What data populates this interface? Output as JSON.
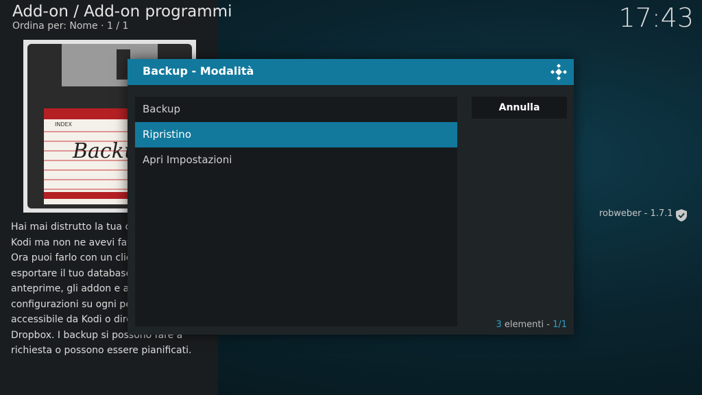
{
  "header": {
    "title": "Add-on / Add-on programmi",
    "subtitle": "Ordina per: Nome · 1 / 1"
  },
  "clock": "17:43",
  "addon": {
    "thumbnail_index_label": "INDEX",
    "thumbnail_label": "Backup",
    "description": "Hai mai distrutto la tua configurazione di Kodi ma non ne avevi fatto un backup? Ora puoi farlo con un click. Puoi esportare il tuo database, playlist, le anteprime, gli addon e altri file di configurazioni su ogni percorso accessibile da Kodi o direttamente su Dropbox. I backup si possono fare a richiesta o possono essere pianificati.",
    "author": "robweber - 1.7.1"
  },
  "dialog": {
    "title": "Backup - Modalità",
    "items": [
      {
        "label": "Backup"
      },
      {
        "label": "Ripristino"
      },
      {
        "label": "Apri Impostazioni"
      }
    ],
    "cancel_label": "Annulla",
    "count_number": "3",
    "count_text": " elementi - ",
    "count_page": "1/1"
  },
  "colors": {
    "accent": "#12799d",
    "accent_text": "#2c9ec9"
  },
  "icons": {
    "logo": "kodi-logo-icon",
    "verified": "shield-check-icon"
  }
}
